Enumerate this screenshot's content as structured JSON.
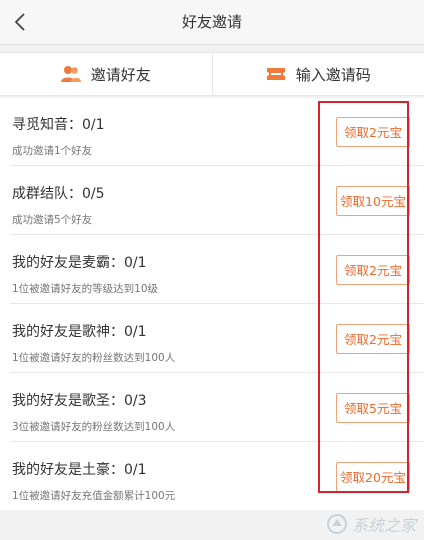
{
  "header": {
    "title": "好友邀请",
    "back_icon": "chevron-left-icon"
  },
  "tabs": [
    {
      "label": "邀请好友",
      "icon": "friends-icon",
      "icon_color": "#f07a3a"
    },
    {
      "label": "输入邀请码",
      "icon": "ticket-icon",
      "icon_color": "#f07a3a"
    }
  ],
  "tasks": [
    {
      "name": "寻觅知音：0/1",
      "desc": "成功邀请1个好友",
      "button": "领取2元宝"
    },
    {
      "name": "成群结队：0/5",
      "desc": "成功邀请5个好友",
      "button": "领取10元宝"
    },
    {
      "name": "我的好友是麦霸：0/1",
      "desc": "1位被邀请好友的等级达到10级",
      "button": "领取2元宝"
    },
    {
      "name": "我的好友是歌神：0/1",
      "desc": "1位被邀请好友的粉丝数达到100人",
      "button": "领取2元宝"
    },
    {
      "name": "我的好友是歌圣：0/3",
      "desc": "3位被邀请好友的粉丝数达到100人",
      "button": "领取5元宝"
    },
    {
      "name": "我的好友是土豪：0/1",
      "desc": "1位被邀请好友充值金额累计100元",
      "button": "领取20元宝"
    }
  ],
  "colors": {
    "accent": "#ee6a2b",
    "highlight": "#d6232b"
  },
  "watermark": {
    "text": "系统之家"
  }
}
